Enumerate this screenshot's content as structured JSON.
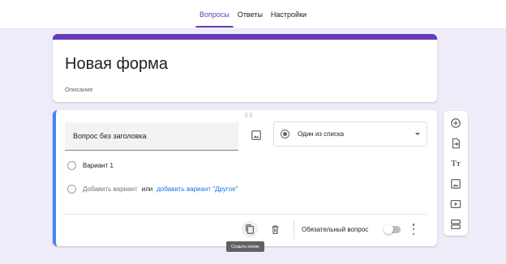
{
  "tabs": [
    {
      "label": "Вопросы",
      "active": true
    },
    {
      "label": "Ответы",
      "active": false
    },
    {
      "label": "Настройки",
      "active": false
    }
  ],
  "form": {
    "title": "Новая форма",
    "description": "Описание"
  },
  "question": {
    "title": "Вопрос без заголовка",
    "type_label": "Один из списка",
    "option1": "Вариант 1",
    "add_option": "Добавить вариант",
    "or": "или",
    "add_other": "добавить вариант \"Другое\"",
    "required_label": "Обязательный вопрос",
    "required": false,
    "copy_tooltip": "Создать копию"
  },
  "colors": {
    "accent": "#673ab7",
    "active_border": "#4285f4",
    "background": "#f0ebf8",
    "link": "#1a73e8"
  },
  "side_toolbar": [
    "add-question-icon",
    "import-questions-icon",
    "add-title-icon",
    "add-image-icon",
    "add-video-icon",
    "add-section-icon"
  ]
}
